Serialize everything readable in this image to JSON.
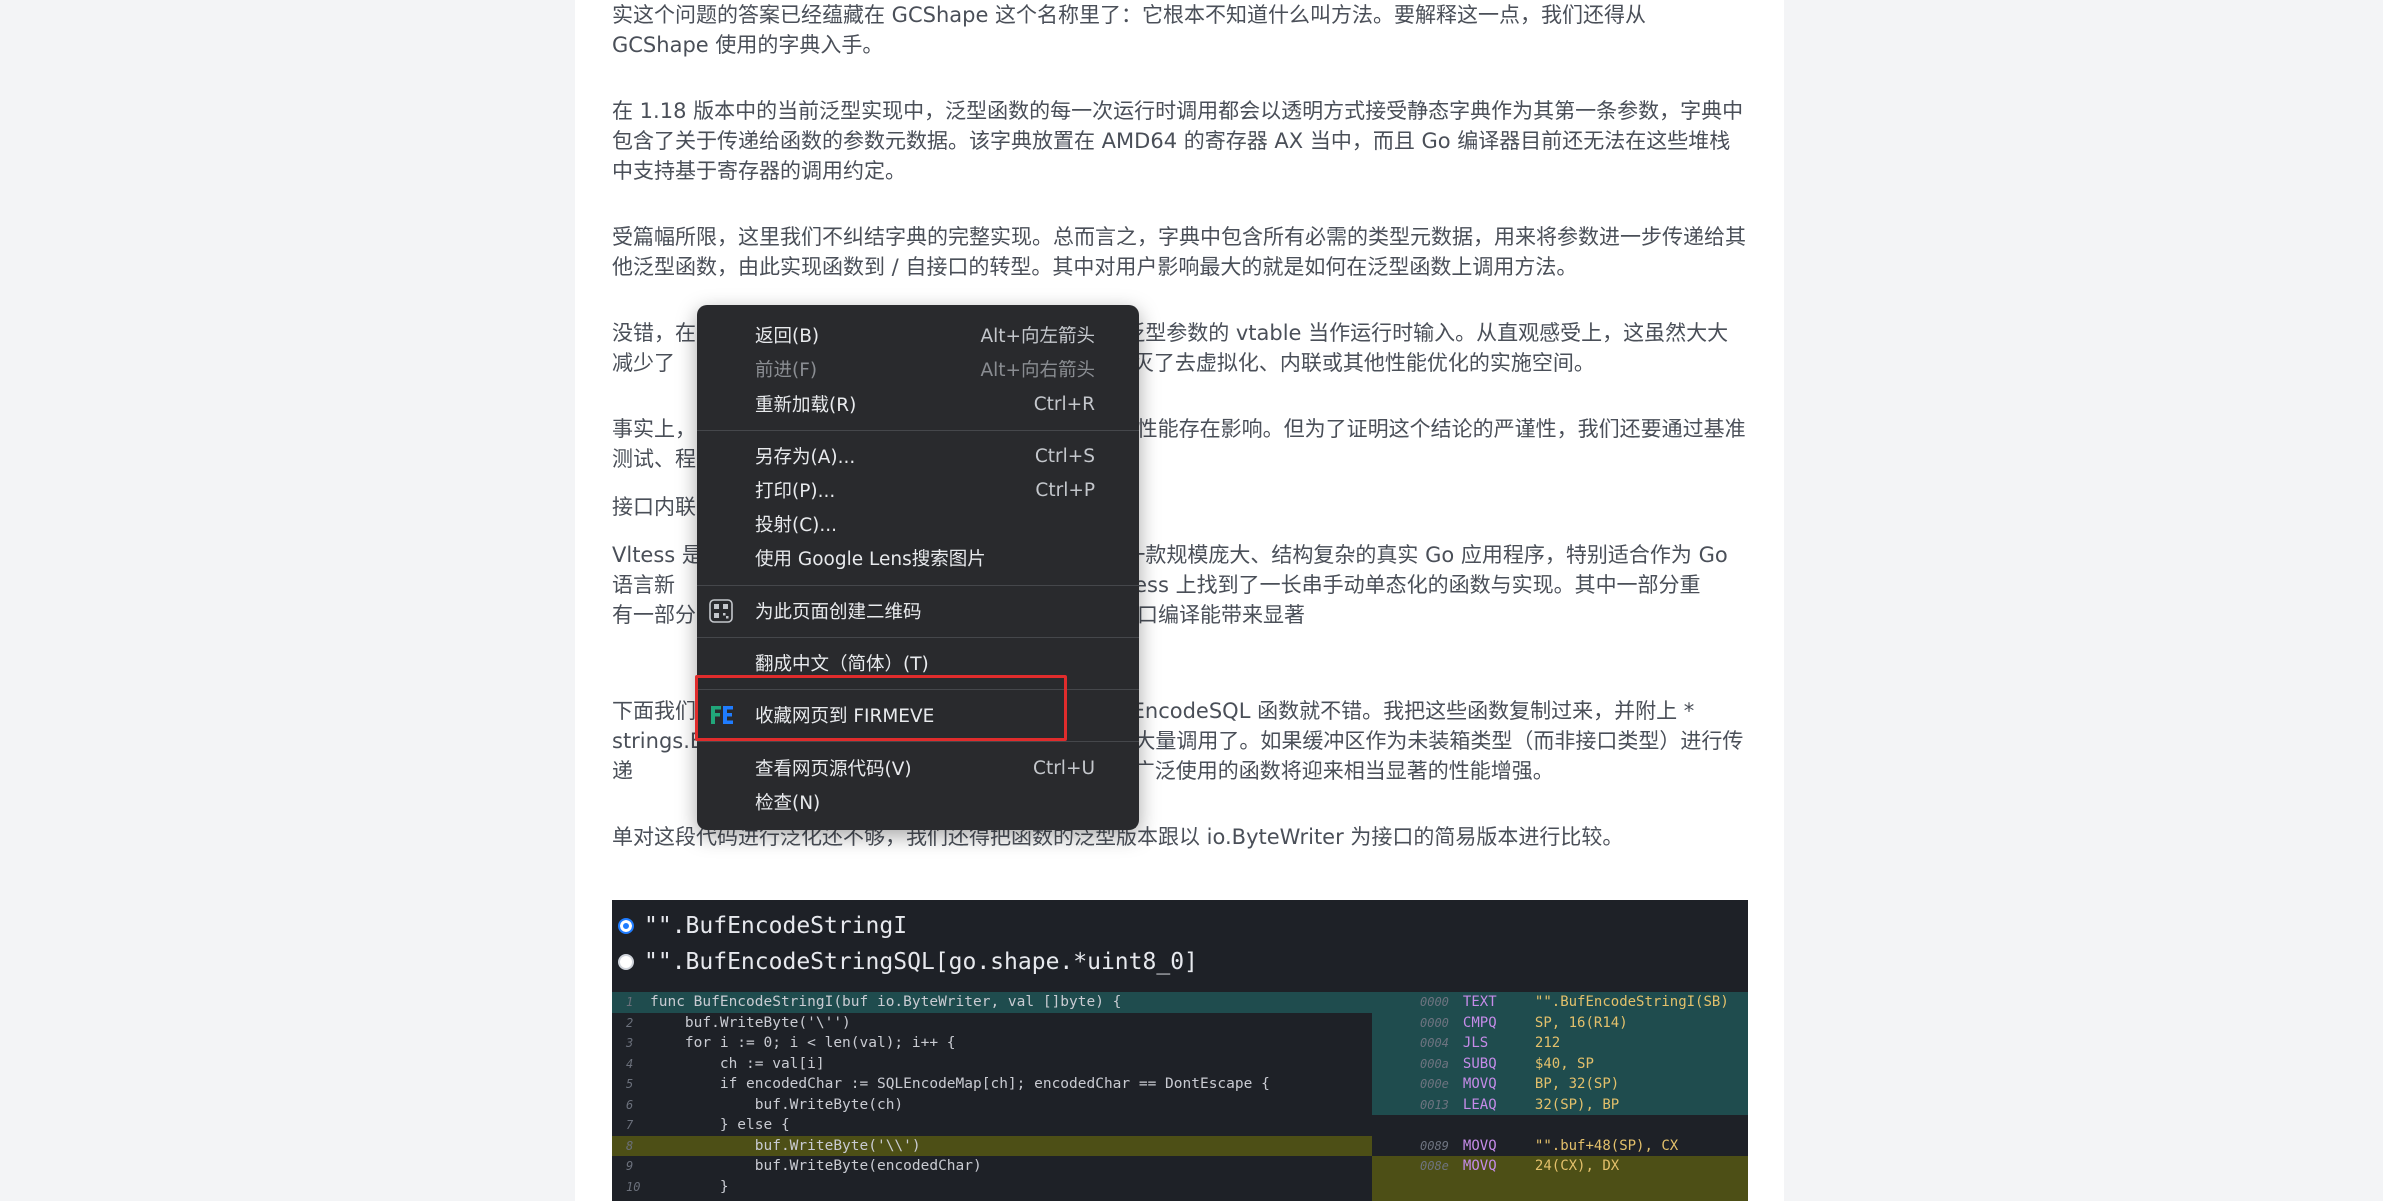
{
  "article": {
    "paragraphs": [
      "实这个问题的答案已经蕴藏在 GCShape 这个名称里了：它根本不知道什么叫方法。要解释这一点，我们还得从 GCShape 使用的字典入手。",
      "在 1.18 版本中的当前泛型实现中，泛型函数的每一次运行时调用都会以透明方式接受静态字典作为其第一条参数，字典中包含了关于传递给函数的参数元数据。该字典放置在 AMD64 的寄存器 AX 当中，而且 Go 编译器目前还无法在这些堆栈中支持基于寄存器的调用约定。",
      "受篇幅所限，这里我们不纠结字典的完整实现。总而言之，字典中包含所有必需的类型元数据，用来将参数进一步传递给其他泛型函数，由此实现函数到 / 自接口的转型。其中对用户影响最大的就是如何在泛型函数上调用方法。",
      "没错，在                                                             有泛型参数的 vtable 当作运行时输入。从直观感受上，这虽然大大减少了                                                        思路也消灭了去虚拟化、内联或其他性能优化的实施空间。",
      "事实上，                                                                  性能存在影响。但为了证明这个结论的严谨性，我们还要通过基准测试、程",
      "接口内联",
      "Vltess 是                                                            是一款规模庞大、结构复杂的真实 Go 应用程序，特别适合作为 Go 语言新                                                   我碰巧在 Vitess 上找到了一长串手动单态化的函数与实现。其中一部分重                                                   有一部分重复函数是因为对性能至关重要，所以避免用接口编译能带来显著",
      "下面我们                                                            BufEncodeSQL 函数就不错。我把这些函数复制过来，并附上 * strings.Bu                                                     区执行大量调用了。如果缓冲区作为未装箱类型（而非接口类型）进行传递                                                     在整个代码库内广泛使用的函数将迎来相当显著的性能增强。",
      "单对这段代码进行泛化还不够，我们还得把函数的泛型版本跟以 io.ByteWriter 为接口的简易版本进行比较。"
    ]
  },
  "code_viewer": {
    "options": [
      {
        "label": "\"\".BufEncodeStringI",
        "selected": true
      },
      {
        "label": "\"\".BufEncodeStringSQL[go.shape.*uint8_0]",
        "selected": false
      }
    ],
    "source_lines": [
      {
        "n": "1",
        "text": "func BufEncodeStringI(buf io.ByteWriter, val []byte) {",
        "hl": "teal"
      },
      {
        "n": "2",
        "text": "    buf.WriteByte('\\'')",
        "hl": ""
      },
      {
        "n": "3",
        "text": "    for i := 0; i < len(val); i++ {",
        "hl": ""
      },
      {
        "n": "4",
        "text": "        ch := val[i]",
        "hl": ""
      },
      {
        "n": "5",
        "text": "        if encodedChar := SQLEncodeMap[ch]; encodedChar == DontEscape {",
        "hl": ""
      },
      {
        "n": "6",
        "text": "            buf.WriteByte(ch)",
        "hl": ""
      },
      {
        "n": "7",
        "text": "        } else {",
        "hl": ""
      },
      {
        "n": "8",
        "text": "            buf.WriteByte('\\\\')",
        "hl": "yellow"
      },
      {
        "n": "9",
        "text": "            buf.WriteByte(encodedChar)",
        "hl": ""
      },
      {
        "n": "10",
        "text": "        }",
        "hl": ""
      }
    ],
    "asm_lines": [
      {
        "addr": "0000",
        "op": "TEXT",
        "args": "\"\".BufEncodeStringI(SB)"
      },
      {
        "addr": "0000",
        "op": "CMPQ",
        "args": "SP, 16(R14)"
      },
      {
        "addr": "0004",
        "op": "JLS",
        "args": "212"
      },
      {
        "addr": "000a",
        "op": "SUBQ",
        "args": "$40, SP"
      },
      {
        "addr": "000e",
        "op": "MOVQ",
        "args": "BP, 32(SP)"
      },
      {
        "addr": "0013",
        "op": "LEAQ",
        "args": "32(SP), BP"
      },
      {
        "addr": "",
        "op": "",
        "args": ""
      },
      {
        "addr": "0089",
        "op": "MOVQ",
        "args": "\"\".buf+48(SP), CX"
      },
      {
        "addr": "008e",
        "op": "MOVQ",
        "args": "24(CX), DX"
      }
    ]
  },
  "context_menu": {
    "items": [
      {
        "label": "返回(B)",
        "shortcut": "Alt+向左箭头",
        "disabled": false,
        "icon": ""
      },
      {
        "label": "前进(F)",
        "shortcut": "Alt+向右箭头",
        "disabled": true,
        "icon": ""
      },
      {
        "label": "重新加载(R)",
        "shortcut": "Ctrl+R",
        "disabled": false,
        "icon": ""
      },
      {
        "label": "另存为(A)...",
        "shortcut": "Ctrl+S",
        "disabled": false,
        "icon": ""
      },
      {
        "label": "打印(P)...",
        "shortcut": "Ctrl+P",
        "disabled": false,
        "icon": ""
      },
      {
        "label": "投射(C)...",
        "shortcut": "",
        "disabled": false,
        "icon": ""
      },
      {
        "label": "使用 Google Lens搜索图片",
        "shortcut": "",
        "disabled": false,
        "icon": ""
      },
      {
        "label": "为此页面创建二维码",
        "shortcut": "",
        "disabled": false,
        "icon": "qr-code-icon"
      },
      {
        "label": "翻成中文（简体）(T)",
        "shortcut": "",
        "disabled": false,
        "icon": ""
      },
      {
        "label": "收藏网页到 FIRMEVE",
        "shortcut": "",
        "disabled": false,
        "icon": "firmeve-logo-icon"
      },
      {
        "label": "查看网页源代码(V)",
        "shortcut": "Ctrl+U",
        "disabled": false,
        "icon": ""
      },
      {
        "label": "检查(N)",
        "shortcut": "",
        "disabled": false,
        "icon": ""
      }
    ]
  },
  "colors": {
    "menu_bg": "#292a2d",
    "highlight_border": "#e02c2c",
    "code_bg": "#1e2127",
    "teal_highlight": "#1f4c4e",
    "yellow_highlight": "#4d4f16"
  }
}
